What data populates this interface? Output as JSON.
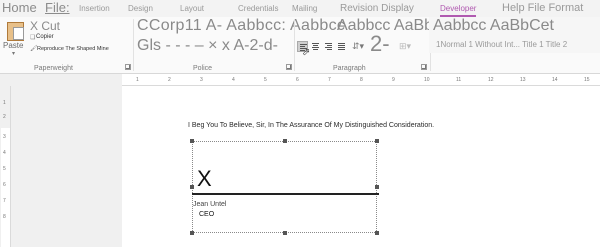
{
  "tabs": [
    {
      "label": "Home"
    },
    {
      "label": "File:"
    },
    {
      "label": "Insertion"
    },
    {
      "label": "Design"
    },
    {
      "label": "Layout"
    },
    {
      "label": "Credentials"
    },
    {
      "label": "Mailing"
    },
    {
      "label": "Revision Display"
    },
    {
      "label": "Developer"
    },
    {
      "label": "Help File Format"
    }
  ],
  "clipboard": {
    "paste": "Paste",
    "cut": "X Cut",
    "copy": "Copier",
    "format_painter": "Reproduce The Shaped Mine",
    "group_label": "Paperweight"
  },
  "font": {
    "row1": "CCorp11 A- Aabbcc: Aabbcc",
    "row2": "Gls - - - – × x A-2-d-",
    "group_label": "Police"
  },
  "paragraph": {
    "row1": "Aabbcc AaBbCet",
    "row2_big": "2-",
    "group_label": "Paragraph"
  },
  "styles": {
    "row1": "Aabbcc AaBbCet",
    "list": "1Normal 1 Without Int... Title 1 Title 2"
  },
  "document": {
    "body_line": "I Beg You To Believe, Sir, In The Assurance Of My Distinguished Consideration.",
    "signature_x": "X",
    "signer_name": "Jean Untel",
    "signer_title": "CEO"
  },
  "ruler": {
    "vertical_numbers": [
      "1",
      "2",
      "3",
      "4",
      "5",
      "6",
      "7",
      "8"
    ],
    "horizontal_numbers": [
      "1",
      "2",
      "3",
      "4",
      "5",
      "6",
      "7",
      "8",
      "9",
      "10",
      "11",
      "12",
      "13",
      "14",
      "15"
    ]
  },
  "colors": {
    "active_tab": "#b05ab0",
    "paste_icon": "#e8c089"
  }
}
